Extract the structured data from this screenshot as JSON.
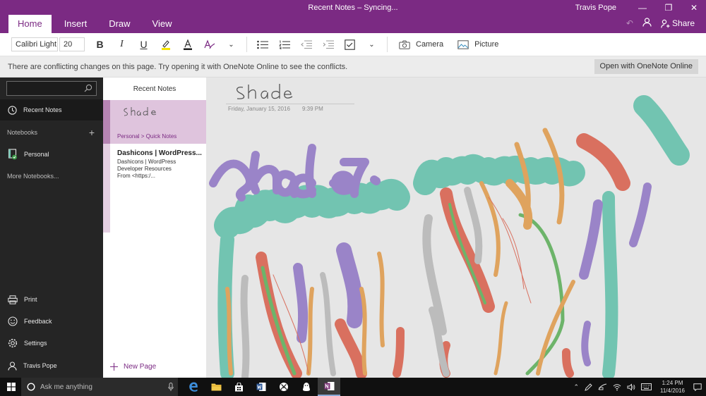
{
  "window": {
    "title": "Recent Notes – Syncing...",
    "user": "Travis Pope",
    "share_label": "Share"
  },
  "tabs": [
    "Home",
    "Insert",
    "Draw",
    "View"
  ],
  "ribbon": {
    "font_name": "Calibri Light",
    "font_size": "20",
    "camera_label": "Camera",
    "picture_label": "Picture"
  },
  "infobar": {
    "message": "There are conflicting changes on this page. Try opening it with OneNote Online to see the conflicts.",
    "button": "Open with OneNote Online"
  },
  "nav": {
    "recent_notes": "Recent Notes",
    "notebooks_label": "Notebooks",
    "notebook_personal": "Personal",
    "more_notebooks": "More Notebooks...",
    "print": "Print",
    "feedback": "Feedback",
    "settings": "Settings",
    "account": "Travis Pope"
  },
  "pagelist": {
    "header": "Recent Notes",
    "selected_crumb": "Personal > Quick Notes",
    "page2_title": "Dashicons | WordPress...",
    "page2_line1": "Dashicons | WordPress",
    "page2_line2": "Developer Resources",
    "page2_line3": "From <https:/...",
    "new_page": "New Page"
  },
  "canvas": {
    "date": "Friday, January 15, 2016",
    "time": "9:39 PM"
  },
  "taskbar": {
    "search_placeholder": "Ask me anything",
    "time": "1:24 PM",
    "date": "11/4/2016"
  },
  "colors": {
    "accent": "#7b2a83",
    "teal": "#72c4b1",
    "purple": "#9a84c8",
    "orange": "#dfa35e",
    "red": "#d9705f",
    "gray": "#bcbcbc",
    "green": "#6db46a"
  }
}
